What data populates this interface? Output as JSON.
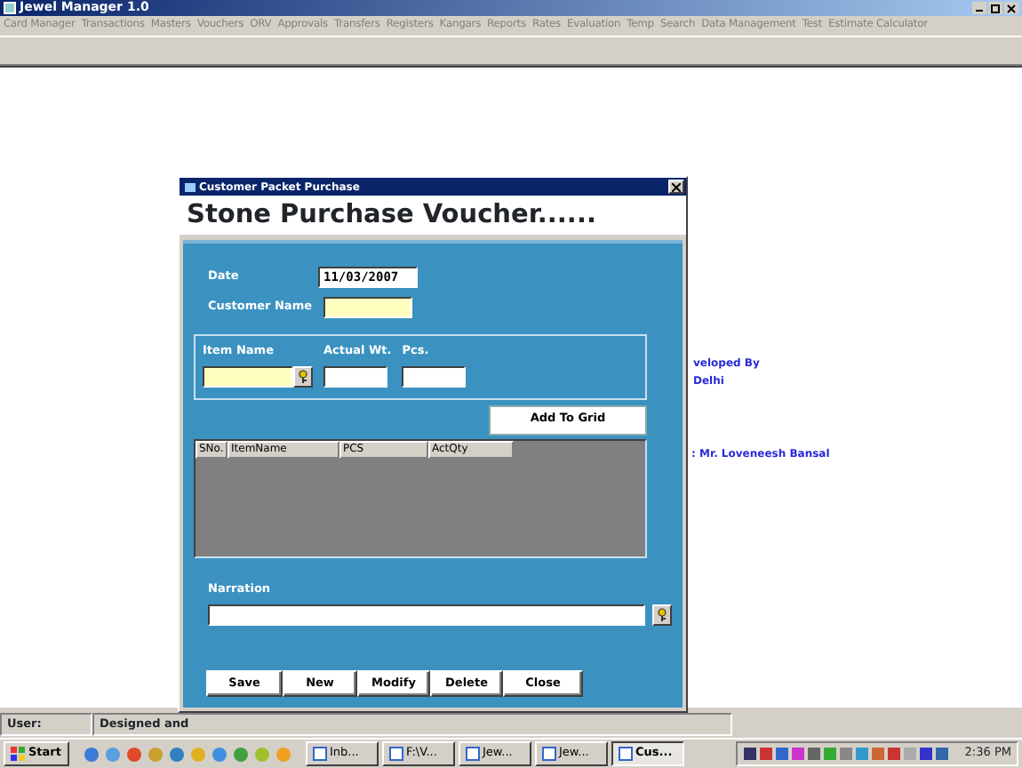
{
  "window": {
    "title": "Jewel Manager 1.0"
  },
  "menu": [
    "Card Manager",
    "Transactions",
    "Masters",
    "Vouchers",
    "ORV",
    "Approvals",
    "Transfers",
    "Registers",
    "Kangars",
    "Reports",
    "Rates",
    "Evaluation",
    "Temp",
    "Search",
    "Data Management",
    "Test",
    "Estimate Calculator"
  ],
  "background_text": [
    "veloped By",
    "Delhi",
    ": Mr. Loveneesh Bansal"
  ],
  "dialog": {
    "title": "Customer Packet Purchase",
    "heading": "Stone Purchase Voucher......",
    "date": {
      "label": "Date",
      "value": "11/03/2007"
    },
    "customer_name": {
      "label": "Customer Name"
    },
    "item_name": {
      "label": "Item Name"
    },
    "actual_wt": {
      "label": "Actual Wt."
    },
    "pcs": {
      "label": "Pcs."
    },
    "add_button": "Add To Grid",
    "grid": {
      "columns": [
        "SNo.",
        "ItemName",
        "PCS",
        "ActQty"
      ]
    },
    "narration": {
      "label": "Narration"
    },
    "buttons": [
      "Save",
      "New",
      "Modify",
      "Delete",
      "Close"
    ]
  },
  "status_bar": [
    "User:",
    "Designed and"
  ],
  "taskbar": {
    "start": "Start",
    "tasks": [
      {
        "label": "Inb...",
        "selected": false
      },
      {
        "label": "F:\\V...",
        "selected": false
      },
      {
        "label": "Jew...",
        "selected": false
      },
      {
        "label": "Jew...",
        "selected": false
      },
      {
        "label": "Cus...",
        "selected": true
      }
    ],
    "clock": "2:36 PM"
  }
}
